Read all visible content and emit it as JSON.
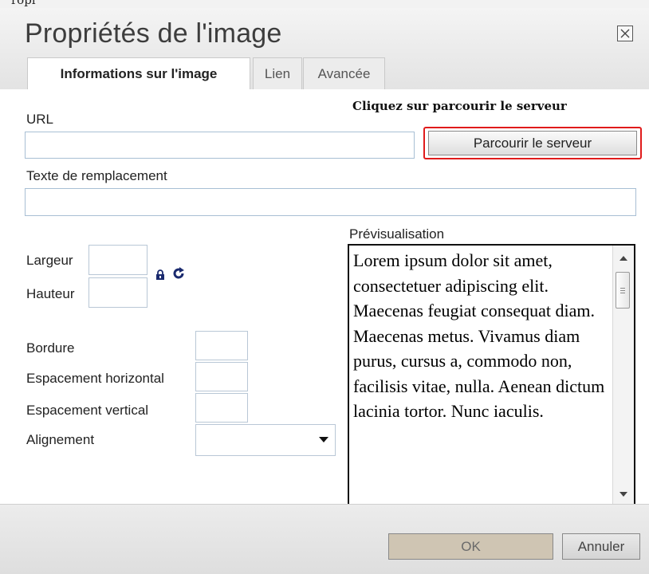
{
  "top_fragment": "ropi",
  "dialog": {
    "title": "Propriétés de l'image",
    "close_icon": "close-icon"
  },
  "tabs": [
    {
      "label": "Informations sur l'image",
      "active": true
    },
    {
      "label": "Lien",
      "active": false
    },
    {
      "label": "Avancée",
      "active": false
    }
  ],
  "form": {
    "annotation": "Cliquez sur parcourir le serveur",
    "url": {
      "label": "URL",
      "value": ""
    },
    "browse_button": "Parcourir le serveur",
    "alt_text": {
      "label": "Texte de remplacement",
      "value": ""
    },
    "width": {
      "label": "Largeur",
      "value": ""
    },
    "height": {
      "label": "Hauteur",
      "value": ""
    },
    "lock_icon": "lock-icon",
    "reset_icon": "refresh-icon",
    "border": {
      "label": "Bordure",
      "value": ""
    },
    "hspace": {
      "label": "Espacement horizontal",
      "value": ""
    },
    "vspace": {
      "label": "Espacement vertical",
      "value": ""
    },
    "align": {
      "label": "Alignement",
      "value": ""
    }
  },
  "preview": {
    "label": "Prévisualisation",
    "text": "Lorem ipsum dolor sit amet, consectetuer adipiscing elit. Maecenas feugiat consequat diam. Maecenas metus. Vivamus diam purus, cursus a, commodo non, facilisis vitae, nulla. Aenean dictum lacinia tortor. Nunc iaculis."
  },
  "footer": {
    "ok": "OK",
    "cancel": "Annuler"
  },
  "colors": {
    "highlight": "#e01b1b",
    "input_border": "#a8bfd4"
  }
}
